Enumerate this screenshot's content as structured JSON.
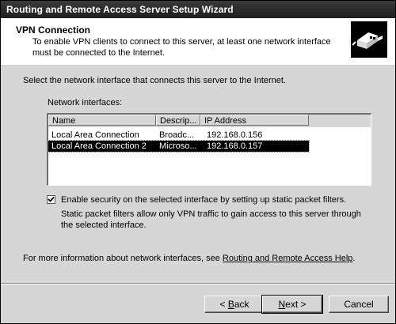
{
  "window": {
    "title": "Routing and Remote Access Server Setup Wizard"
  },
  "header": {
    "title": "VPN Connection",
    "description": "To enable VPN clients to connect to this server, at least one network interface must be connected to the Internet.",
    "icon": "network-plug-icon"
  },
  "main": {
    "prompt": "Select the network interface that connects this server to the Internet.",
    "interfaces_label": "Network interfaces:",
    "columns": [
      "Name",
      "Descrip...",
      "IP Address"
    ],
    "rows": [
      {
        "name": "Local Area Connection",
        "description": "Broadc...",
        "ip": "192.168.0.156"
      },
      {
        "name": "Local Area Connection 2",
        "description": "Microso...",
        "ip": "192.168.0.157"
      }
    ],
    "selected_row": 1,
    "security_checkbox": {
      "checked": true,
      "label": "Enable security on the selected interface by setting up static packet filters."
    },
    "filters_note": "Static packet filters allow only VPN traffic to gain access to this server through the selected interface.",
    "more_info_prefix": "For more information about network interfaces, see ",
    "more_info_link": "Routing and Remote Access Help",
    "more_info_suffix": "."
  },
  "buttons": {
    "back_prefix": "< ",
    "back_accel": "B",
    "back_rest": "ack",
    "next_accel": "N",
    "next_rest": "ext >",
    "cancel": "Cancel"
  }
}
